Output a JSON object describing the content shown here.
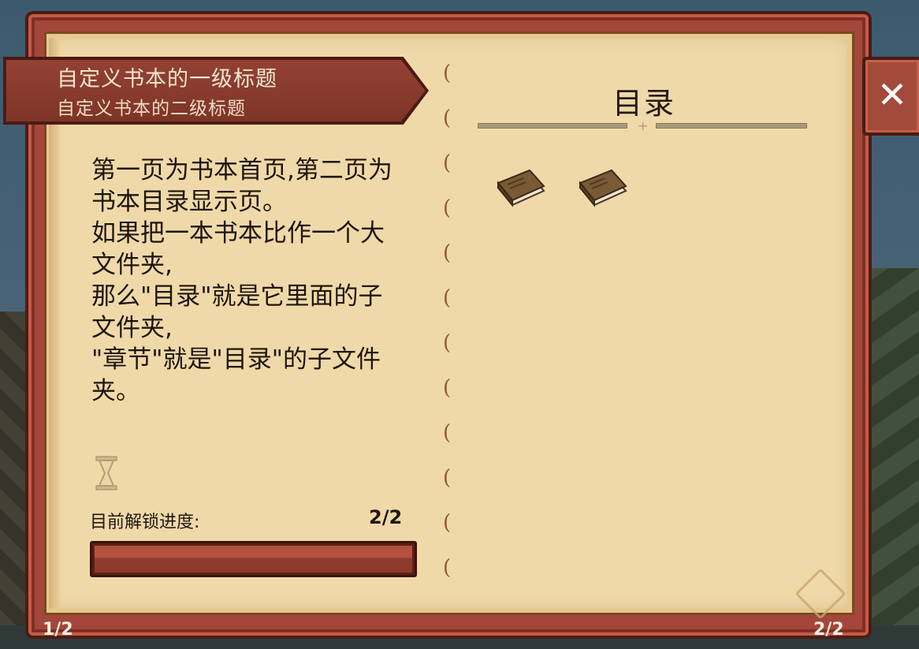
{
  "ribbon": {
    "title": "自定义书本的一级标题",
    "subtitle": "自定义书本的二级标题"
  },
  "left_page": {
    "lines": [
      "第一页为书本首页,第二页为",
      "书本目录显示页。",
      "如果把一本书本比作一个大",
      "文件夹,",
      "那么\"目录\"就是它里面的子",
      "文件夹,",
      "\"章节\"就是\"目录\"的子文件",
      "夹。"
    ],
    "progress_label": "目前解锁进度:",
    "progress_value": "2/2",
    "progress_fraction": 1.0
  },
  "right_page": {
    "title": "目录",
    "entries": [
      {
        "icon": "book-icon"
      },
      {
        "icon": "book-icon"
      }
    ]
  },
  "close_label": "✕",
  "page_left": "1/2",
  "page_right": "2/2",
  "colors": {
    "frame": "#a4473a",
    "page": "#f0d9a9",
    "ribbon": "#8a3b2d",
    "progress_fill": "#b4513f",
    "text": "#1d150d"
  }
}
